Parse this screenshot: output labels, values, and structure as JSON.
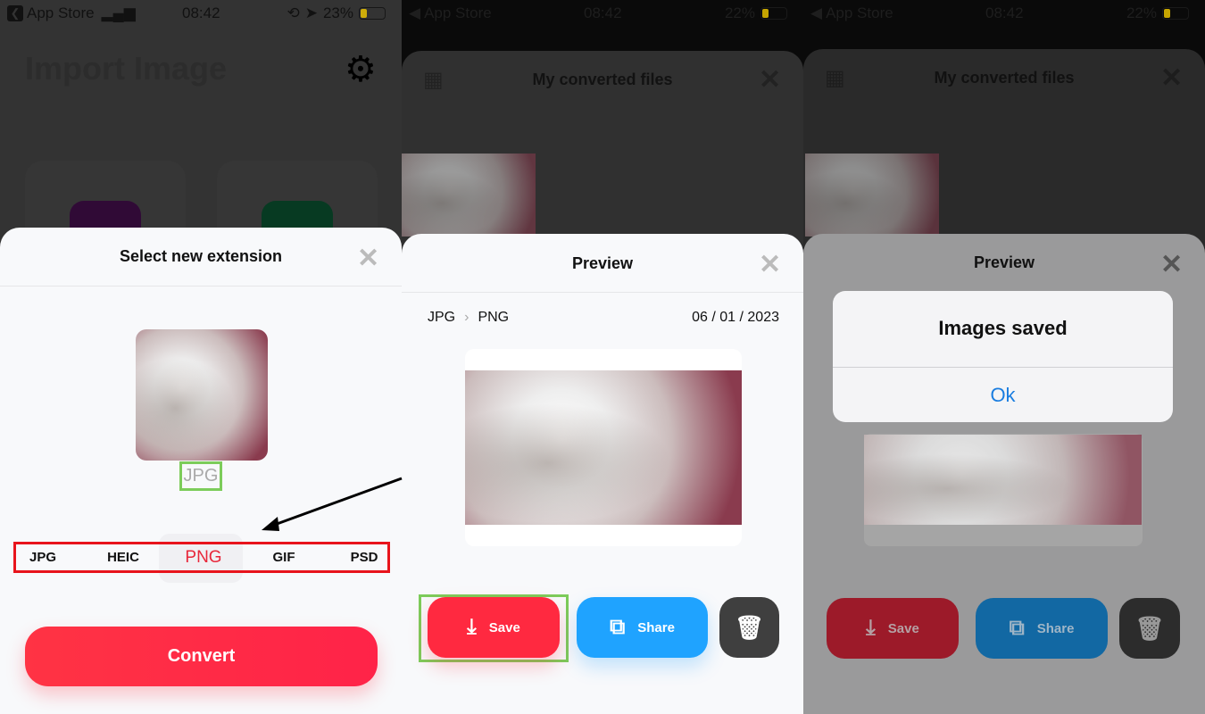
{
  "panels": [
    {
      "status": {
        "back": "App Store",
        "time": "08:42",
        "battery": "23%"
      },
      "background": {
        "title": "Import Image"
      },
      "sheet": {
        "title": "Select new extension",
        "current_format": "JPG",
        "formats": [
          "JPG",
          "HEIC",
          "PNG",
          "GIF",
          "PSD"
        ],
        "selected_format": "PNG",
        "convert_label": "Convert"
      }
    },
    {
      "status": {
        "back": "App Store",
        "time": "08:42",
        "battery": "22%"
      },
      "files": {
        "title": "My converted files"
      },
      "preview": {
        "title": "Preview",
        "from": "JPG",
        "to": "PNG",
        "date": "06 / 01 / 2023",
        "save_label": "Save",
        "share_label": "Share"
      }
    },
    {
      "status": {
        "back": "App Store",
        "time": "08:42",
        "battery": "22%"
      },
      "files": {
        "title": "My converted files"
      },
      "preview": {
        "title": "Preview",
        "save_label": "Save",
        "share_label": "Share"
      },
      "alert": {
        "title": "Images saved",
        "ok_label": "Ok"
      }
    }
  ],
  "colors": {
    "accent_red": "#ff2940",
    "share_blue": "#1fa3ff",
    "highlight_green": "#7ccc5a",
    "annotation_red": "#e8141c",
    "link_blue": "#1a7de0"
  }
}
